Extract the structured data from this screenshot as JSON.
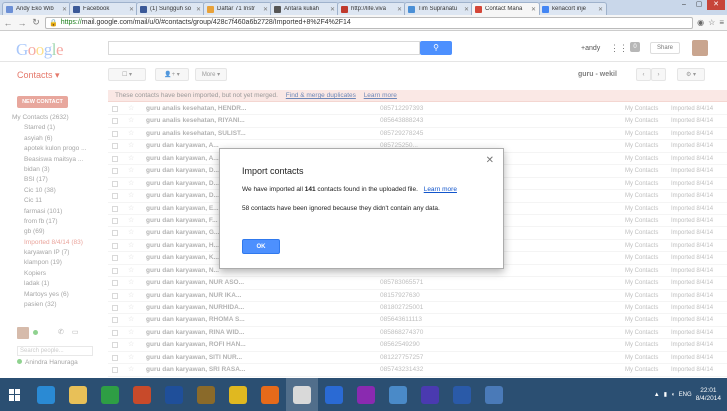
{
  "browser": {
    "tabs": [
      {
        "label": "Andy Eko Wib",
        "color": "#6b8fd6"
      },
      {
        "label": "Facebook",
        "color": "#3b5998"
      },
      {
        "label": "(1) Sungguh so",
        "color": "#3b5998"
      },
      {
        "label": "Daftar 71 Instr",
        "color": "#e8a23a"
      },
      {
        "label": "Antara kuliah",
        "color": "#555555"
      },
      {
        "label": "http://life.viva",
        "color": "#c0392b"
      },
      {
        "label": "Tim Supranatu",
        "color": "#4a8fd6"
      },
      {
        "label": "Contact Mana",
        "color": "#d44638",
        "active": true
      },
      {
        "label": "kenacort inje",
        "color": "#4285f4"
      }
    ],
    "url_scheme": "https://",
    "url_rest": "mail.google.com/mail/u/0/#contacts/group/428c7f460a6b2728/Imported+8%2F4%2F14"
  },
  "header": {
    "logo": "Google",
    "user": "+andy",
    "notif_count": "0",
    "share_label": "Share",
    "search_icon": "search-icon"
  },
  "toolbar": {
    "title": "Contacts",
    "more_label": "More",
    "group_name": "guru - wekil"
  },
  "notice": {
    "text": "These contacts have been imported, but not yet merged.",
    "link1": "Find & merge duplicates",
    "link2": "Learn more"
  },
  "sidebar": {
    "new_contact": "NEW CONTACT",
    "items": [
      {
        "label": "My Contacts (2632)",
        "top": true
      },
      {
        "label": "Starred (1)"
      },
      {
        "label": "asyiah (6)"
      },
      {
        "label": "apotek kulon progo ..."
      },
      {
        "label": "Beasiswa maitsya ..."
      },
      {
        "label": "bidan (3)"
      },
      {
        "label": "BSI (17)"
      },
      {
        "label": "Cic 10 (38)"
      },
      {
        "label": "Cic 11"
      },
      {
        "label": "farmasi (101)"
      },
      {
        "label": "from fb (17)"
      },
      {
        "label": "gb (69)"
      },
      {
        "label": "Imported 8/4/14 (83)",
        "selected": true
      },
      {
        "label": "karyawan IP (7)"
      },
      {
        "label": "klampon (19)"
      },
      {
        "label": "Kopiers"
      },
      {
        "label": "ladak (1)"
      },
      {
        "label": "Martoys yes (6)"
      },
      {
        "label": "pasien (32)"
      }
    ],
    "search_people": "Search people...",
    "chat_contact": "Anindra Hanuraga"
  },
  "contacts": {
    "rows": [
      {
        "name": "guru analis kesehatan, HENDR...",
        "phone": "085712297393",
        "tag1": "My Contacts",
        "tag2": "Imported 8/4/14"
      },
      {
        "name": "guru analis kesehatan, RIYANI...",
        "phone": "085643888243",
        "tag1": "My Contacts",
        "tag2": "Imported 8/4/14"
      },
      {
        "name": "guru analis kesehatan, SULIST...",
        "phone": "085729278245",
        "tag1": "My Contacts",
        "tag2": "Imported 8/4/14"
      },
      {
        "name": "guru dan karyawan, A...",
        "phone": "085725250...",
        "tag1": "My Contacts",
        "tag2": "Imported 8/4/14"
      },
      {
        "name": "guru dan karyawan, A...",
        "phone": "",
        "tag1": "My Contacts",
        "tag2": "Imported 8/4/14"
      },
      {
        "name": "guru dan karyawan, D...",
        "phone": "",
        "tag1": "My Contacts",
        "tag2": "Imported 8/4/14"
      },
      {
        "name": "guru dan karyawan, D...",
        "phone": "",
        "tag1": "My Contacts",
        "tag2": "Imported 8/4/14"
      },
      {
        "name": "guru dan karyawan, D...",
        "phone": "",
        "tag1": "My Contacts",
        "tag2": "Imported 8/4/14"
      },
      {
        "name": "guru dan karyawan, E...",
        "phone": "",
        "tag1": "My Contacts",
        "tag2": "Imported 8/4/14"
      },
      {
        "name": "guru dan karyawan, F...",
        "phone": "",
        "tag1": "My Contacts",
        "tag2": "Imported 8/4/14"
      },
      {
        "name": "guru dan karyawan, G...",
        "phone": "",
        "tag1": "My Contacts",
        "tag2": "Imported 8/4/14"
      },
      {
        "name": "guru dan karyawan, H...",
        "phone": "",
        "tag1": "My Contacts",
        "tag2": "Imported 8/4/14"
      },
      {
        "name": "guru dan karyawan, K...",
        "phone": "",
        "tag1": "My Contacts",
        "tag2": "Imported 8/4/14"
      },
      {
        "name": "guru dan karyawan, N...",
        "phone": "",
        "tag1": "My Contacts",
        "tag2": "Imported 8/4/14"
      },
      {
        "name": "guru dan karyawan, NUR ASO...",
        "phone": "085783065571",
        "tag1": "My Contacts",
        "tag2": "Imported 8/4/14"
      },
      {
        "name": "guru dan karyawan, NUR IKA...",
        "phone": "08157927630",
        "tag1": "My Contacts",
        "tag2": "Imported 8/4/14"
      },
      {
        "name": "guru dan karyawan, NURHIDA...",
        "phone": "081802725001",
        "tag1": "My Contacts",
        "tag2": "Imported 8/4/14"
      },
      {
        "name": "guru dan karyawan, RHOMA S...",
        "phone": "085643611113",
        "tag1": "My Contacts",
        "tag2": "Imported 8/4/14"
      },
      {
        "name": "guru dan karyawan, RINA WID...",
        "phone": "085868274370",
        "tag1": "My Contacts",
        "tag2": "Imported 8/4/14"
      },
      {
        "name": "guru dan karyawan, ROFI HAN...",
        "phone": "08562549290",
        "tag1": "My Contacts",
        "tag2": "Imported 8/4/14"
      },
      {
        "name": "guru dan karyawan, SITI NUR...",
        "phone": "081227757257",
        "tag1": "My Contacts",
        "tag2": "Imported 8/4/14"
      },
      {
        "name": "guru dan karyawan, SRI RASA...",
        "phone": "085743231432",
        "tag1": "My Contacts",
        "tag2": "Imported 8/4/14"
      }
    ]
  },
  "dialog": {
    "title": "Import contacts",
    "msg_prefix": "We have imported all",
    "count": "141",
    "msg_suffix": "contacts found in the uploaded file.",
    "learn_more": "Learn more",
    "msg2": "58 contacts have been ignored because they didn't contain any data.",
    "ok_label": "OK"
  },
  "taskbar": {
    "apps": [
      {
        "name": "ie-icon",
        "color": "#2a8ad4"
      },
      {
        "name": "explorer-icon",
        "color": "#e8c058"
      },
      {
        "name": "store-icon",
        "color": "#2e9e44"
      },
      {
        "name": "app-red-icon",
        "color": "#c84a2a"
      },
      {
        "name": "help-icon",
        "color": "#1f4f9a"
      },
      {
        "name": "tool-icon",
        "color": "#8a6a2a"
      },
      {
        "name": "globe-icon",
        "color": "#e0b820"
      },
      {
        "name": "firefox-icon",
        "color": "#e66a1a"
      },
      {
        "name": "chrome-icon",
        "color": "#d9d9d9",
        "active": true
      },
      {
        "name": "lync-icon",
        "color": "#2a6ad4"
      },
      {
        "name": "onenote-icon",
        "color": "#8a2ab0"
      },
      {
        "name": "network-icon",
        "color": "#4a8ac8"
      },
      {
        "name": "media-icon",
        "color": "#4a3ab0"
      },
      {
        "name": "word-icon",
        "color": "#2a5aa8"
      },
      {
        "name": "paint-icon",
        "color": "#4a7ab8"
      }
    ],
    "lang": "ENG",
    "time": "22:01",
    "date": "8/4/2014"
  }
}
